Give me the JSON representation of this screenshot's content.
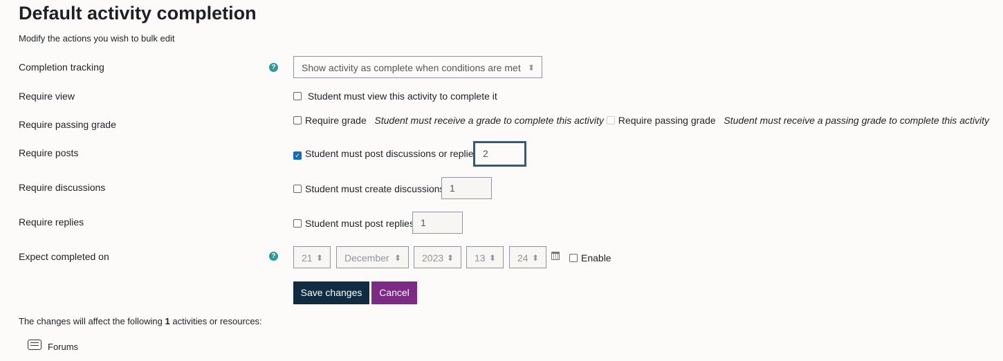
{
  "title": "Default activity completion",
  "subtitle": "Modify the actions you wish to bulk edit",
  "fields": {
    "tracking": {
      "label": "Completion tracking",
      "value": "Show activity as complete when conditions are met"
    },
    "view": {
      "label": "Require view",
      "text": "Student must view this activity to complete it",
      "checked": false
    },
    "passing": {
      "label": "Require passing grade",
      "grade_text": "Require grade",
      "grade_help": "Student must receive a grade to complete this activity",
      "pass_text": "Require passing grade",
      "pass_help": "Student must receive a passing grade to complete this activity"
    },
    "posts": {
      "label": "Require posts",
      "text": "Student must post discussions or replies:",
      "value": "2",
      "checked": true
    },
    "discussions": {
      "label": "Require discussions",
      "text": "Student must create discussions:",
      "value": "1",
      "checked": false
    },
    "replies": {
      "label": "Require replies",
      "text": "Student must post replies:",
      "value": "1",
      "checked": false
    },
    "expect": {
      "label": "Expect completed on",
      "day": "21",
      "month": "December",
      "year": "2023",
      "hour": "13",
      "minute": "24",
      "enable": "Enable",
      "checked": false
    }
  },
  "buttons": {
    "save": "Save changes",
    "cancel": "Cancel"
  },
  "colors": {
    "save": "#0f2c42",
    "cancel": "#7d2a85",
    "help": "#2a9a9a"
  },
  "affect": {
    "prefix": "The changes will affect the following ",
    "count": "1",
    "suffix": " activities or resources:"
  },
  "activities": [
    {
      "name": "Forums",
      "icon": "forum-icon"
    }
  ]
}
